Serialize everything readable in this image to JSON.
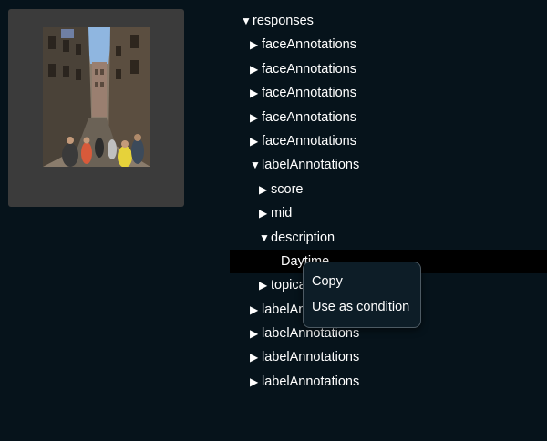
{
  "tree": {
    "root": {
      "label": "responses",
      "expanded": true
    },
    "rows": [
      {
        "label": "faceAnnotations",
        "expanded": false
      },
      {
        "label": "faceAnnotations",
        "expanded": false
      },
      {
        "label": "faceAnnotations",
        "expanded": false
      },
      {
        "label": "faceAnnotations",
        "expanded": false
      },
      {
        "label": "faceAnnotations",
        "expanded": false
      },
      {
        "label": "labelAnnotations",
        "expanded": true
      },
      {
        "label": "score",
        "expanded": false
      },
      {
        "label": "mid",
        "expanded": false
      },
      {
        "label": "description",
        "expanded": true
      },
      {
        "label": "Daytime",
        "leaf": true,
        "selected": true
      },
      {
        "label": "topicality",
        "expanded": false
      },
      {
        "label": "labelAnnotations",
        "expanded": false
      },
      {
        "label": "labelAnnotations",
        "expanded": false
      },
      {
        "label": "labelAnnotations",
        "expanded": false
      },
      {
        "label": "labelAnnotations",
        "expanded": false
      }
    ],
    "collapsed_icon": "triangle-right-icon",
    "expanded_icon": "triangle-down-icon"
  },
  "context_menu": {
    "items": [
      {
        "label": "Copy"
      },
      {
        "label": "Use as condition"
      }
    ]
  },
  "colors": {
    "background": "#06131b",
    "thumbnail_panel": "#3b3b3b",
    "selected_row": "#000000",
    "menu_background": "#0d1d27",
    "menu_border": "#4d5a63",
    "text": "#ffffff"
  }
}
